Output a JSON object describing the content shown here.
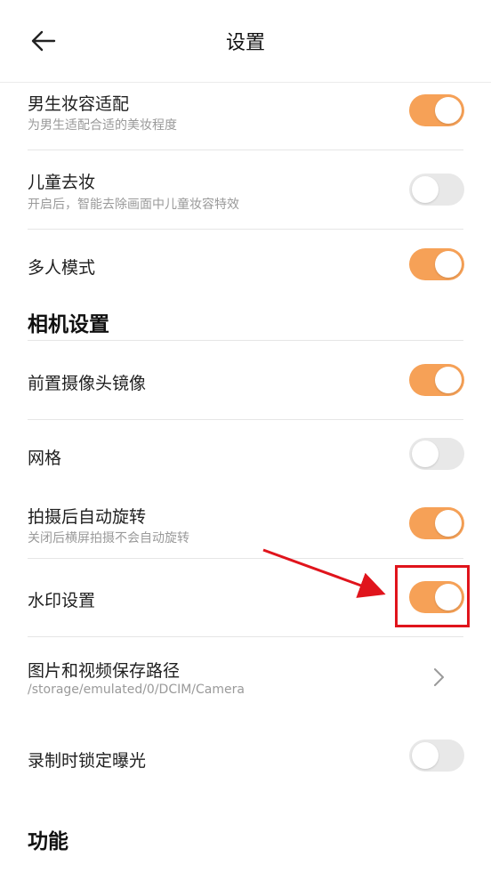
{
  "header": {
    "title": "设置",
    "back_icon": "arrow-left-icon"
  },
  "settings": [
    {
      "label": "男生妆容适配",
      "sub": "为男生适配合适的美妆程度",
      "toggle": "on"
    },
    {
      "label": "儿童去妆",
      "sub": "开启后，智能去除画面中儿童妆容特效",
      "toggle": "off"
    },
    {
      "label": "多人模式",
      "toggle": "on"
    }
  ],
  "camera_section": {
    "title": "相机设置"
  },
  "camera_settings": [
    {
      "label": "前置摄像头镜像",
      "toggle": "on"
    },
    {
      "label": "网格",
      "toggle": "off"
    },
    {
      "label": "拍摄后自动旋转",
      "sub": "关闭后横屏拍摄不会自动旋转",
      "toggle": "on"
    },
    {
      "label": "水印设置",
      "toggle": "on"
    },
    {
      "label": "图片和视频保存路径",
      "sub": "/storage/emulated/0/DCIM/Camera",
      "icon": "chevron-right-icon"
    },
    {
      "label": "录制时锁定曝光",
      "toggle": "off"
    }
  ],
  "function_section": {
    "title": "功能"
  },
  "colors": {
    "accent": "#f6a157",
    "off": "#e8e8e8",
    "annotation": "#e0141c"
  }
}
